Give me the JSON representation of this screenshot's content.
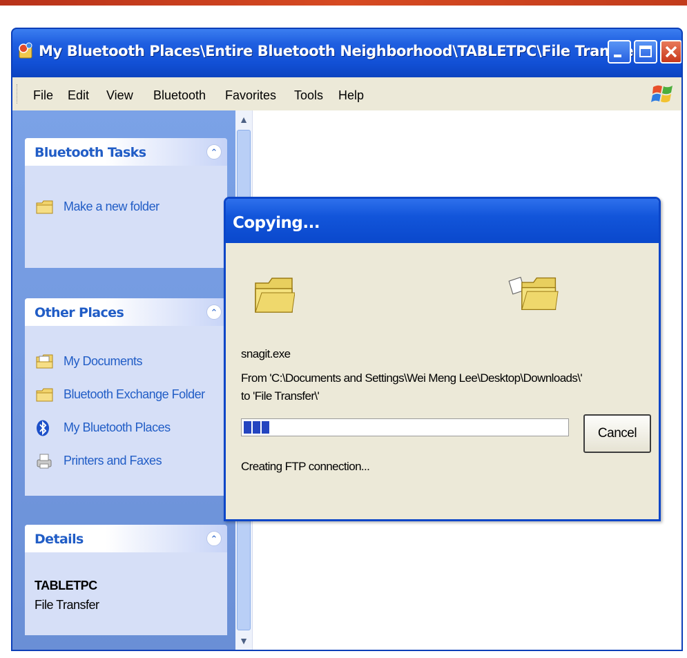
{
  "window": {
    "title": "My Bluetooth Places\\Entire Bluetooth Neighborhood\\TABLETPC\\File Transfer"
  },
  "menu": {
    "items": [
      "File",
      "Edit",
      "View",
      "Bluetooth",
      "Favorites",
      "Tools",
      "Help"
    ]
  },
  "sidebar": {
    "bluetooth_tasks": {
      "title": "Bluetooth Tasks",
      "items": [
        {
          "label": "Make a new folder",
          "icon": "folder-icon"
        }
      ]
    },
    "other_places": {
      "title": "Other Places",
      "items": [
        {
          "label": "My Documents",
          "icon": "my-documents-icon"
        },
        {
          "label": "Bluetooth Exchange Folder",
          "icon": "folder-icon"
        },
        {
          "label": "My Bluetooth Places",
          "icon": "bluetooth-icon"
        },
        {
          "label": "Printers and Faxes",
          "icon": "printer-icon"
        }
      ]
    },
    "details": {
      "title": "Details",
      "name": "TABLETPC",
      "sub": "File Transfer"
    }
  },
  "dialog": {
    "title": "Copying...",
    "file_name": "snagit.exe",
    "from_line": "From 'C:\\Documents and Settings\\Wei Meng Lee\\Desktop\\Downloads\\'",
    "to_line": "to 'File Transfer\\'",
    "progress": 0.09,
    "cancel_label": "Cancel",
    "status": "Creating FTP connection..."
  },
  "colors": {
    "titlebar_blue": "#1250d6",
    "link_blue": "#215dc6",
    "dialog_bg": "#ece9d8",
    "top_accent": "#c23c1c"
  }
}
